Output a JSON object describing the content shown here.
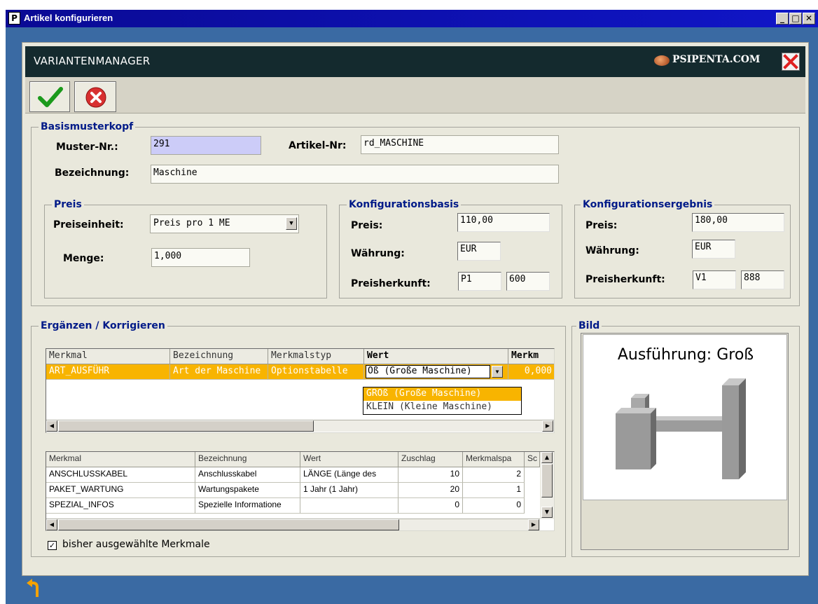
{
  "window": {
    "icon_letter": "P",
    "title": "Artikel konfigurieren",
    "min": "_",
    "max": "□",
    "close": "✕"
  },
  "header": {
    "title": "VARIANTENMANAGER",
    "brand": "PSIPENTA.COM"
  },
  "colors": {
    "selection": "#f8b400",
    "header_bg": "#142a2e",
    "frame_bg": "#3a6aa3",
    "group_title": "#001a88"
  },
  "basis": {
    "group_title": "Basismusterkopf",
    "muster_label": "Muster-Nr.:",
    "muster_value": "291",
    "artikel_label": "Artikel-Nr:",
    "artikel_value": "rd_MASCHINE",
    "bez_label": "Bezeichnung:",
    "bez_value": "Maschine"
  },
  "preis": {
    "group_title": "Preis",
    "einheit_label": "Preiseinheit:",
    "einheit_value": "Preis pro 1 ME",
    "menge_label": "Menge:",
    "menge_value": "1,000"
  },
  "konfigbasis": {
    "group_title": "Konfigurationsbasis",
    "preis_label": "Preis:",
    "preis_value": "110,00",
    "waehrung_label": "Währung:",
    "waehrung_value": "EUR",
    "herkunft_label": "Preisherkunft:",
    "herkunft_1": "P1",
    "herkunft_2": "600"
  },
  "konfigergebnis": {
    "group_title": "Konfigurationsergebnis",
    "preis_label": "Preis:",
    "preis_value": "180,00",
    "waehrung_label": "Währung:",
    "waehrung_value": "EUR",
    "herkunft_label": "Preisherkunft:",
    "herkunft_1": "V1",
    "herkunft_2": "888"
  },
  "ergaenzen": {
    "group_title": "Ergänzen / Korrigieren",
    "grid1": {
      "headers": [
        "Merkmal",
        "Bezeichnung",
        "Merkmalstyp",
        "Wert",
        "Merkm"
      ],
      "row": {
        "merkmal": "ART_AUSFÜHR",
        "bez": "Art der Maschine",
        "typ": "Optionstabelle",
        "wert": "Oß (Große Maschine)",
        "merkm": "0,000"
      },
      "dropdown": [
        "GROß (Große Maschine)",
        "KLEIN (Kleine Maschine)"
      ]
    },
    "grid2": {
      "headers": [
        "Merkmal",
        "Bezeichnung",
        "Wert",
        "Zuschlag",
        "Merkmalspa",
        "Sc"
      ],
      "rows": [
        {
          "merkmal": "ANSCHLUSSKABEL",
          "bez": "Anschlusskabel",
          "wert": "LÄNGE (Länge des",
          "zuschlag": "10",
          "merkmalspa": "2"
        },
        {
          "merkmal": "PAKET_WARTUNG",
          "bez": "Wartungspakete",
          "wert": "1 Jahr (1 Jahr)",
          "zuschlag": "20",
          "merkmalspa": "1"
        },
        {
          "merkmal": "SPEZIAL_INFOS",
          "bez": "Spezielle Informatione",
          "wert": "",
          "zuschlag": "0",
          "merkmalspa": "0"
        }
      ]
    },
    "checkbox_label": "bisher ausgewählte Merkmale",
    "checkbox_mark": "✓"
  },
  "bild": {
    "group_title": "Bild",
    "caption": "Ausführung: Groß"
  }
}
